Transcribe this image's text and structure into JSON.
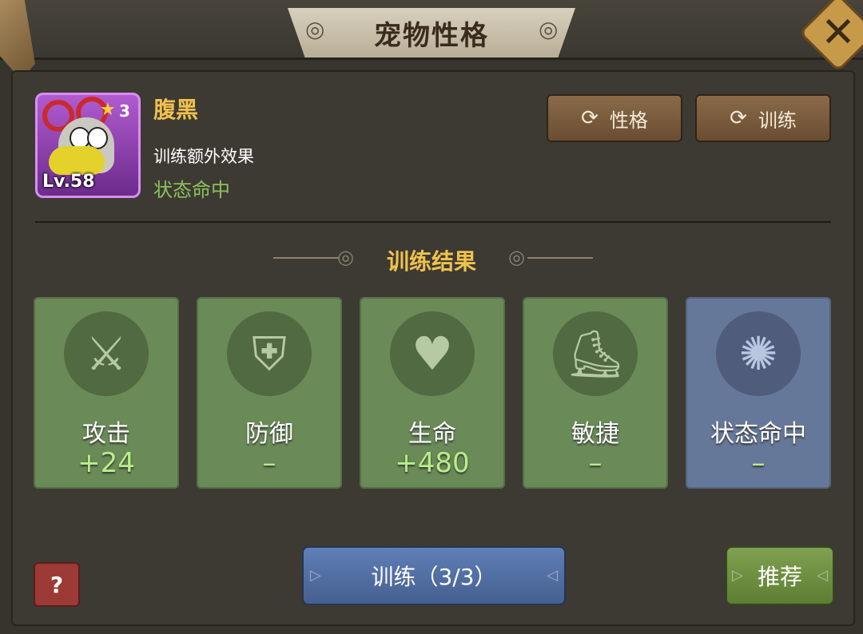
{
  "header": {
    "title": "宠物性格",
    "close_glyph": "✕"
  },
  "pet": {
    "name": "腹黑",
    "rank": "3",
    "level": "Lv.58",
    "bonus_label": "训练额外效果",
    "bonus_value": "状态命中",
    "frame_color": "#a24cc6"
  },
  "actions": {
    "personality_label": "性格",
    "train_label": "训练",
    "refresh_icon": "refresh-icon"
  },
  "results": {
    "title": "训练结果",
    "cards": [
      {
        "label": "攻击",
        "value": "+24",
        "icon": "sword-icon",
        "color": "#6a8a58"
      },
      {
        "label": "防御",
        "value": "–",
        "icon": "shield-icon",
        "color": "#6a8a58"
      },
      {
        "label": "生命",
        "value": "+480",
        "icon": "heart-plus-icon",
        "color": "#6a8a58"
      },
      {
        "label": "敏捷",
        "value": "–",
        "icon": "boot-icon",
        "color": "#6a8a58"
      },
      {
        "label": "状态命中",
        "value": "–",
        "icon": "spiral-badge-icon",
        "color": "#66789a"
      }
    ]
  },
  "footer": {
    "help_label": "?",
    "train_button": "训练（3/3）",
    "recommend_button": "推荐"
  }
}
